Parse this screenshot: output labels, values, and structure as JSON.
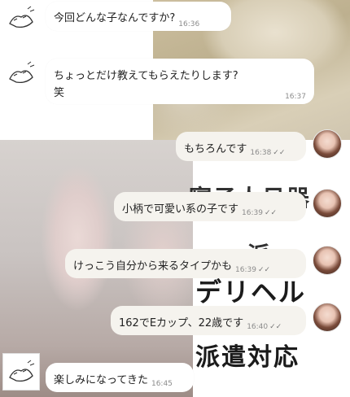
{
  "messages": [
    {
      "side": "left",
      "text": "今回どんな子なんですか?",
      "time": "16:36"
    },
    {
      "side": "left",
      "text_line1": "ちょっとだけ教えてもらえたりします?",
      "text_line2": "笑",
      "time": "16:37"
    },
    {
      "side": "right",
      "text": "もちろんです",
      "time": "16:38",
      "read_icon": "double-check"
    },
    {
      "side": "right",
      "text": "小柄で可愛い系の子です",
      "time": "16:39",
      "read_icon": "double-check"
    },
    {
      "side": "right",
      "text": "けっこう自分から来るタイプかも",
      "time": "16:39",
      "read_icon": "double-check"
    },
    {
      "side": "right",
      "text": "162でEカップ、22歳です",
      "time": "16:40",
      "read_icon": "double-check"
    },
    {
      "side": "left",
      "text": "楽しみになってきた",
      "time": "16:45"
    }
  ],
  "read_mark": "✓✓",
  "overlay_text": {
    "line1": "寝子人日器",
    "line2": "ーー 派",
    "line3": "デリヘル",
    "line4": "派遣対応"
  },
  "colors": {
    "bubble_bg": "#f5f3ee",
    "time_text": "#8c8c8c"
  },
  "icons": {
    "left_avatar": "sketch-avatar-icon",
    "right_avatar": "profile-photo-avatar"
  }
}
